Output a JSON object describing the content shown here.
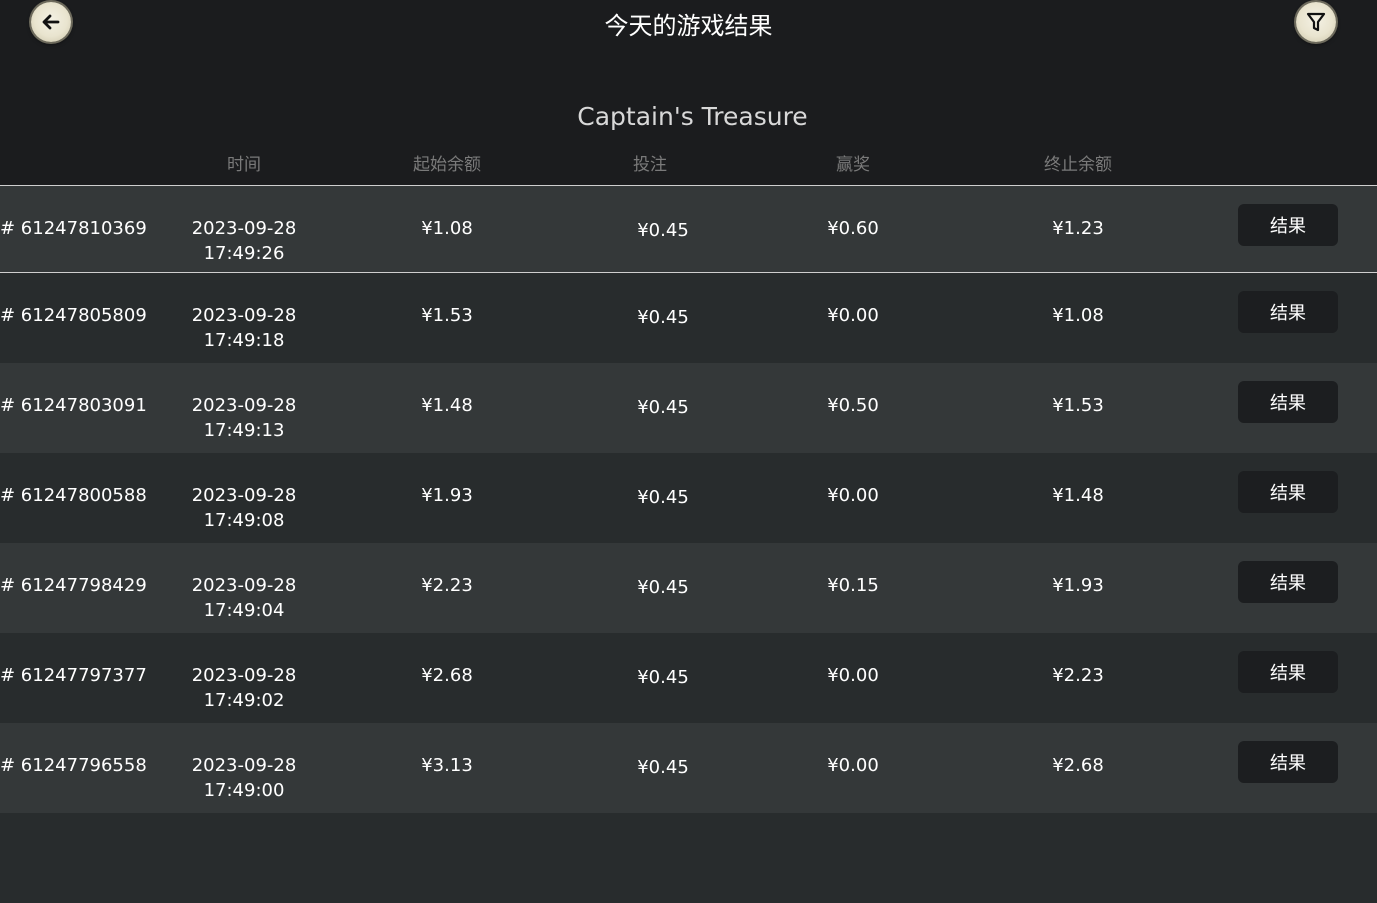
{
  "header": {
    "title": "今天的游戏结果",
    "back_icon": "back-arrow-icon",
    "filter_icon": "filter-funnel-icon"
  },
  "game_title": "Captain's Treasure",
  "columns": {
    "time": "时间",
    "start_balance": "起始余额",
    "bet": "投注",
    "win": "赢奖",
    "end_balance": "终止余额"
  },
  "rows": [
    {
      "id": "# 61247810369",
      "date": "2023-09-28",
      "time": "17:49:26",
      "start": "¥1.08",
      "bet": "¥0.45",
      "win": "¥0.60",
      "end": "¥1.23",
      "button": "结果"
    },
    {
      "id": "# 61247805809",
      "date": "2023-09-28",
      "time": "17:49:18",
      "start": "¥1.53",
      "bet": "¥0.45",
      "win": "¥0.00",
      "end": "¥1.08",
      "button": "结果"
    },
    {
      "id": "# 61247803091",
      "date": "2023-09-28",
      "time": "17:49:13",
      "start": "¥1.48",
      "bet": "¥0.45",
      "win": "¥0.50",
      "end": "¥1.53",
      "button": "结果"
    },
    {
      "id": "# 61247800588",
      "date": "2023-09-28",
      "time": "17:49:08",
      "start": "¥1.93",
      "bet": "¥0.45",
      "win": "¥0.00",
      "end": "¥1.48",
      "button": "结果"
    },
    {
      "id": "# 61247798429",
      "date": "2023-09-28",
      "time": "17:49:04",
      "start": "¥2.23",
      "bet": "¥0.45",
      "win": "¥0.15",
      "end": "¥1.93",
      "button": "结果"
    },
    {
      "id": "# 61247797377",
      "date": "2023-09-28",
      "time": "17:49:02",
      "start": "¥2.68",
      "bet": "¥0.45",
      "win": "¥0.00",
      "end": "¥2.23",
      "button": "结果"
    },
    {
      "id": "# 61247796558",
      "date": "2023-09-28",
      "time": "17:49:00",
      "start": "¥3.13",
      "bet": "¥0.45",
      "win": "¥0.00",
      "end": "¥2.68",
      "button": "结果"
    }
  ]
}
